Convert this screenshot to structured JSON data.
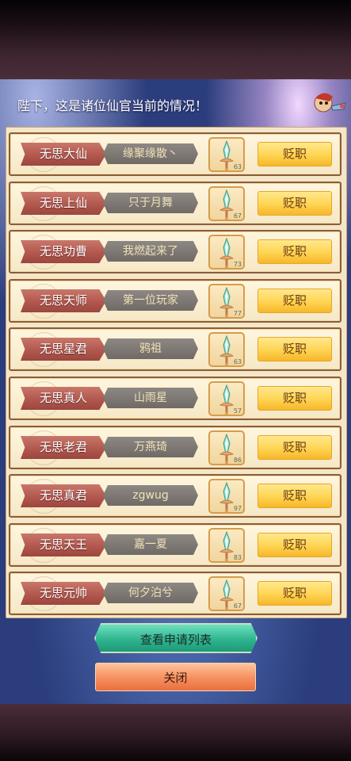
{
  "header": {
    "message": "陛下，这是诸位仙官当前的情况！"
  },
  "officials": [
    {
      "title": "无思大仙",
      "name": "缘聚缘散丶",
      "level": "63",
      "action": "贬职"
    },
    {
      "title": "无思上仙",
      "name": "只于月舞",
      "level": "67",
      "action": "贬职"
    },
    {
      "title": "无思功曹",
      "name": "我燃起来了",
      "level": "73",
      "action": "贬职"
    },
    {
      "title": "无思天师",
      "name": "第一位玩家",
      "level": "77",
      "action": "贬职"
    },
    {
      "title": "无思星君",
      "name": "鸦祖",
      "level": "63",
      "action": "贬职"
    },
    {
      "title": "无思真人",
      "name": "山雨星",
      "level": "57",
      "action": "贬职"
    },
    {
      "title": "无思老君",
      "name": "万燕琦",
      "level": "86",
      "action": "贬职"
    },
    {
      "title": "无思真君",
      "name": "zgwug",
      "level": "97",
      "action": "贬职"
    },
    {
      "title": "无思天王",
      "name": "嘉一夏",
      "level": "83",
      "action": "贬职"
    },
    {
      "title": "无思元帅",
      "name": "何夕泊兮",
      "level": "67",
      "action": "贬职"
    }
  ],
  "buttons": {
    "view_applications": "查看申请列表",
    "close": "关闭"
  },
  "icons": {
    "item": "sword-artifact-icon",
    "mascot": "mascot-icon"
  }
}
